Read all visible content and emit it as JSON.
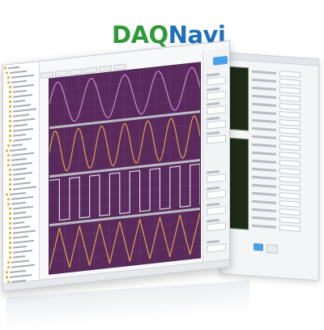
{
  "logo": {
    "part1": "DAQ",
    "part2": "Navi"
  },
  "colors": {
    "logo_green": "#2f9a3a",
    "logo_blue": "#1f70b8",
    "plot_background": "#5a2a5c",
    "wave_1": "#c98bd0",
    "wave_2": "#e0a24b",
    "wave_3": "#d9dde2",
    "wave_4": "#e0a24b",
    "separator": "#b9bcc2"
  },
  "chart_data": {
    "type": "line",
    "series": [
      {
        "shape": "sine",
        "cycles": 4.5
      },
      {
        "shape": "sine",
        "cycles": 6.5
      },
      {
        "shape": "square",
        "cycles": 7.5
      },
      {
        "shape": "triangle",
        "cycles": 7.5
      }
    ]
  }
}
